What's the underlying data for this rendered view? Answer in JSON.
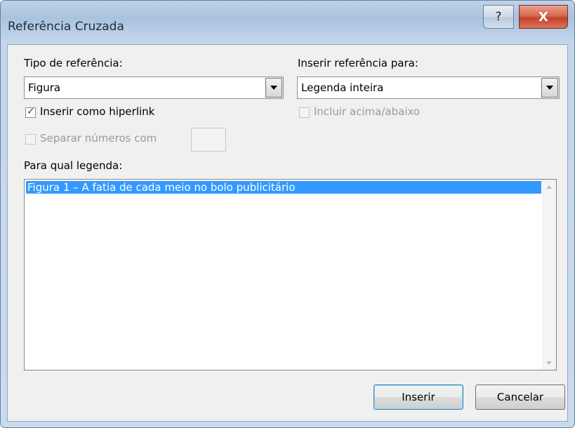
{
  "window": {
    "title": "Referência Cruzada"
  },
  "titlebar": {
    "help_glyph": "?",
    "close_glyph": "X"
  },
  "reference_type": {
    "label": "Tipo de referência:",
    "value": "Figura"
  },
  "insert_reference_to": {
    "label": "Inserir referência para:",
    "value": "Legenda inteira"
  },
  "insert_hyperlink": {
    "label": "Inserir como hiperlink",
    "checked": true
  },
  "include_above_below": {
    "label": "Incluir acima/abaixo",
    "checked": false,
    "enabled": false
  },
  "separate_numbers": {
    "label": "Separar números com",
    "checked": false,
    "enabled": false,
    "value": ""
  },
  "caption_list": {
    "label": "Para qual legenda:",
    "items": [
      "Figura 1 – A fatia de cada meio no bolo publicitário"
    ],
    "selected_index": 0
  },
  "buttons": {
    "insert": "Inserir",
    "cancel": "Cancelar"
  },
  "colors": {
    "selection": "#3399ff",
    "titlebar": "#b9d1ea",
    "close_button": "#c7432b"
  },
  "icons": {
    "help": "question-mark-icon",
    "close": "close-icon",
    "dropdown": "chevron-down-icon",
    "check": "check-icon"
  }
}
